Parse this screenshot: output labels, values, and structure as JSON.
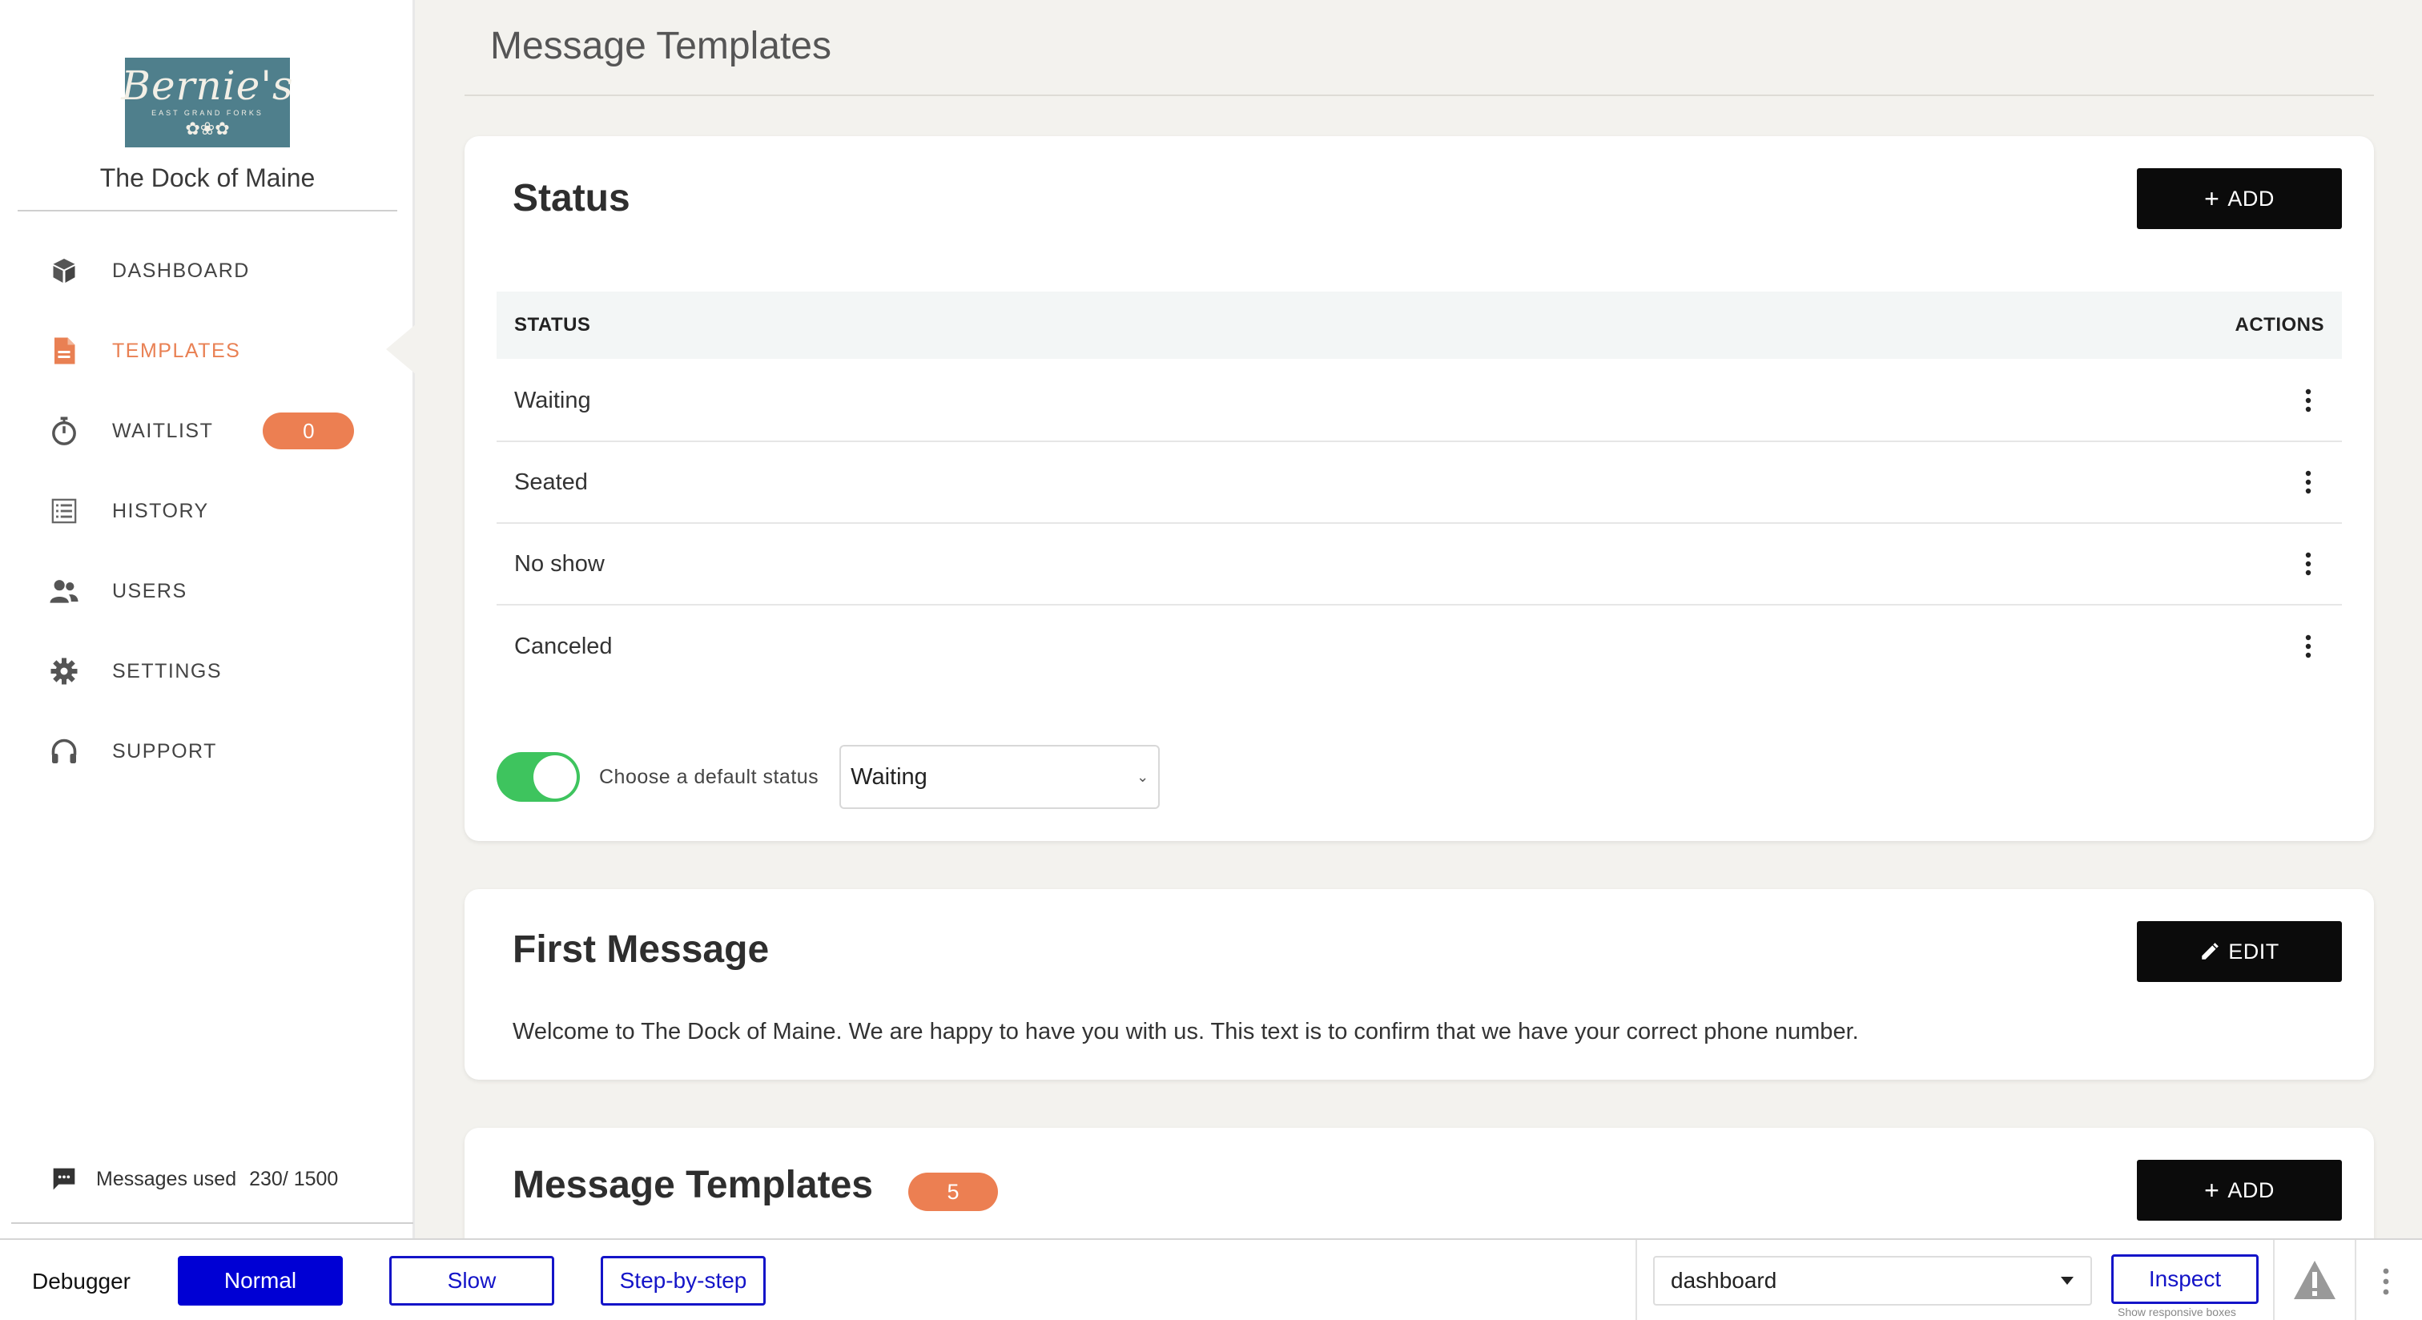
{
  "app": {
    "page_title": "Message Templates"
  },
  "sidebar": {
    "logo": {
      "script": "Bernie's",
      "subtitle": "EAST GRAND FORKS",
      "ornament": "✿❀✿"
    },
    "restaurant_name": "The Dock of Maine",
    "items": [
      {
        "label": "DASHBOARD",
        "icon": "cube-icon",
        "active": false
      },
      {
        "label": "TEMPLATES",
        "icon": "document-icon",
        "active": true
      },
      {
        "label": "WAITLIST",
        "icon": "stopwatch-icon",
        "active": false,
        "badge": "0"
      },
      {
        "label": "HISTORY",
        "icon": "list-icon",
        "active": false
      },
      {
        "label": "USERS",
        "icon": "users-icon",
        "active": false
      },
      {
        "label": "SETTINGS",
        "icon": "gear-icon",
        "active": false
      },
      {
        "label": "SUPPORT",
        "icon": "headphones-icon",
        "active": false
      }
    ],
    "messages_used": {
      "label": "Messages used",
      "value": "230/ 1500"
    },
    "accent_color": "#e98053"
  },
  "status_card": {
    "title": "Status",
    "add_label": "ADD",
    "columns": [
      "STATUS",
      "ACTIONS"
    ],
    "rows": [
      "Waiting",
      "Seated",
      "No show",
      "Canceled"
    ],
    "default_toggle_on": true,
    "default_label": "Choose a default status",
    "default_value": "Waiting",
    "toggle_color": "#3ec45e"
  },
  "first_message_card": {
    "title": "First Message",
    "edit_label": "EDIT",
    "body": "Welcome to The Dock of Maine. We are happy to have you with us. This text is to confirm that we have your correct phone number."
  },
  "templates_card": {
    "title": "Message Templates",
    "count": "5",
    "add_label": "ADD"
  },
  "debugger": {
    "label": "Debugger",
    "modes": [
      "Normal",
      "Slow",
      "Step-by-step"
    ],
    "active_mode": "Normal",
    "page_select": "dashboard",
    "inspect_label": "Inspect",
    "hint": "Show responsive boxes",
    "accent_color": "#1414c8"
  }
}
